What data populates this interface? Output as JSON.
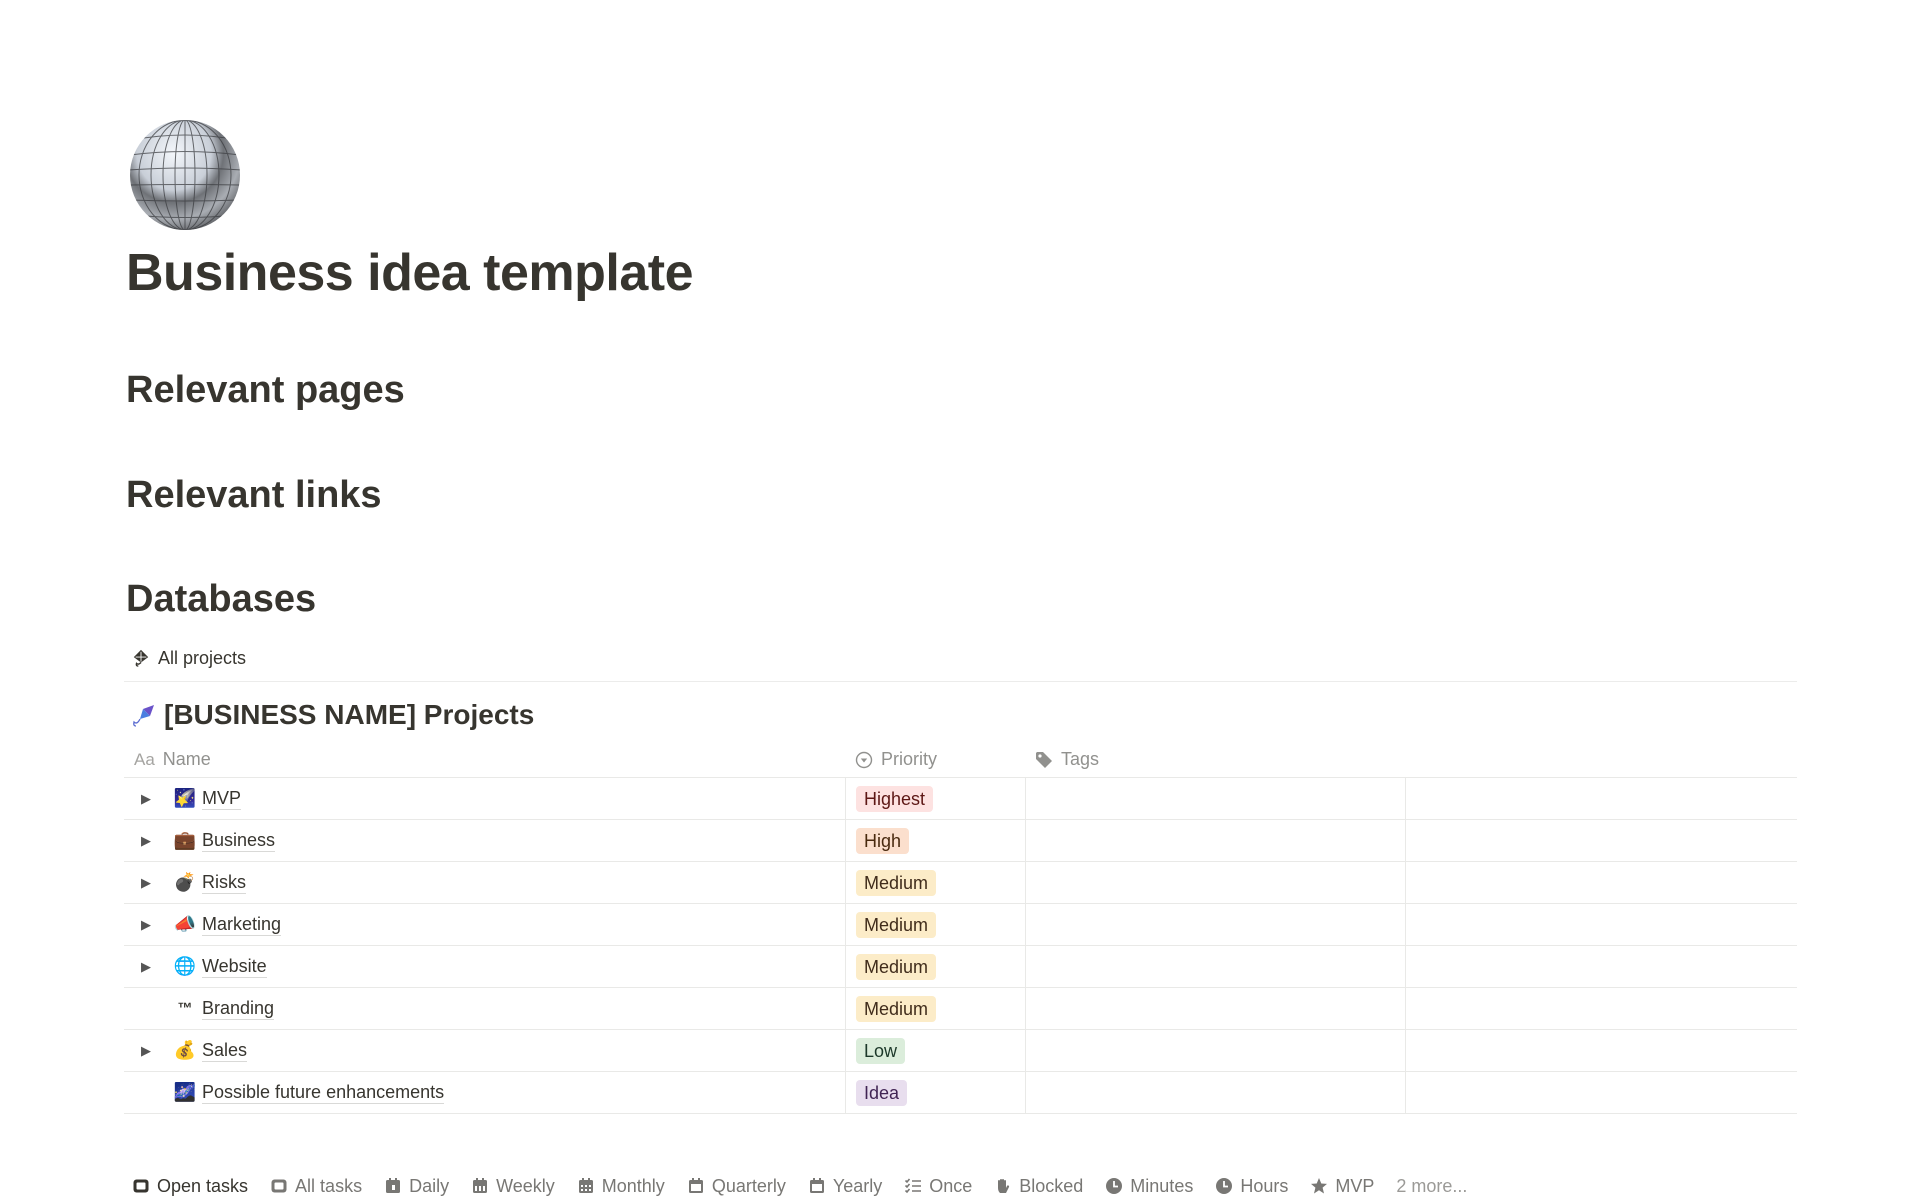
{
  "page": {
    "icon": "mirror-ball-icon",
    "title": "Business idea template"
  },
  "sections": [
    {
      "heading": "Relevant pages"
    },
    {
      "heading": "Relevant links"
    },
    {
      "heading": "Databases"
    }
  ],
  "database": {
    "view_tab": {
      "label": "All projects",
      "icon": "kite-outline-icon"
    },
    "title": "[BUSINESS NAME] Projects",
    "title_icon": "kite-icon",
    "columns": [
      {
        "label": "Name",
        "icon": "text-type-icon",
        "icon_text": "Aa"
      },
      {
        "label": "Priority",
        "icon": "select-icon"
      },
      {
        "label": "Tags",
        "icon": "tag-icon"
      }
    ],
    "rows": [
      {
        "name": "MVP",
        "icon": "🌠",
        "icon_name": "shooting-star-icon",
        "expandable": true,
        "priority": "Highest"
      },
      {
        "name": "Business",
        "icon": "💼",
        "icon_name": "briefcase-icon",
        "expandable": true,
        "priority": "High"
      },
      {
        "name": "Risks",
        "icon": "💣",
        "icon_name": "bomb-icon",
        "expandable": true,
        "priority": "Medium"
      },
      {
        "name": "Marketing",
        "icon": "📣",
        "icon_name": "megaphone-icon",
        "expandable": true,
        "priority": "Medium"
      },
      {
        "name": "Website",
        "icon": "🌐",
        "icon_name": "globe-icon",
        "expandable": true,
        "priority": "Medium"
      },
      {
        "name": "Branding",
        "icon": "™",
        "icon_name": "trademark-icon",
        "expandable": false,
        "priority": "Medium"
      },
      {
        "name": "Sales",
        "icon": "💰",
        "icon_name": "money-bag-icon",
        "expandable": true,
        "priority": "Low"
      },
      {
        "name": "Possible future enhancements",
        "icon": "🌌",
        "icon_name": "milky-way-icon",
        "expandable": false,
        "priority": "Idea"
      }
    ],
    "priority_colors": {
      "Highest": {
        "bg": "#fde2e1",
        "fg": "#5d1715"
      },
      "High": {
        "bg": "#fbdfcd",
        "fg": "#49290e"
      },
      "Medium": {
        "bg": "#fcecc8",
        "fg": "#402c1b"
      },
      "Low": {
        "bg": "#dbeddb",
        "fg": "#1c3829"
      },
      "Idea": {
        "bg": "#e8deee",
        "fg": "#412454"
      }
    }
  },
  "tabs": [
    {
      "label": "Open tasks",
      "icon": "task-list-icon",
      "active": true
    },
    {
      "label": "All tasks",
      "icon": "task-list-icon",
      "active": false
    },
    {
      "label": "Daily",
      "icon": "calendar-day-icon",
      "active": false
    },
    {
      "label": "Weekly",
      "icon": "calendar-week-icon",
      "active": false
    },
    {
      "label": "Monthly",
      "icon": "calendar-month-icon",
      "active": false
    },
    {
      "label": "Quarterly",
      "icon": "calendar-icon",
      "active": false
    },
    {
      "label": "Yearly",
      "icon": "calendar-icon",
      "active": false
    },
    {
      "label": "Once",
      "icon": "checklist-icon",
      "active": false
    },
    {
      "label": "Blocked",
      "icon": "hand-icon",
      "active": false
    },
    {
      "label": "Minutes",
      "icon": "clock-icon",
      "active": false
    },
    {
      "label": "Hours",
      "icon": "clock-icon",
      "active": false
    },
    {
      "label": "MVP",
      "icon": "star-icon",
      "active": false
    }
  ],
  "tabs_more": "2 more..."
}
